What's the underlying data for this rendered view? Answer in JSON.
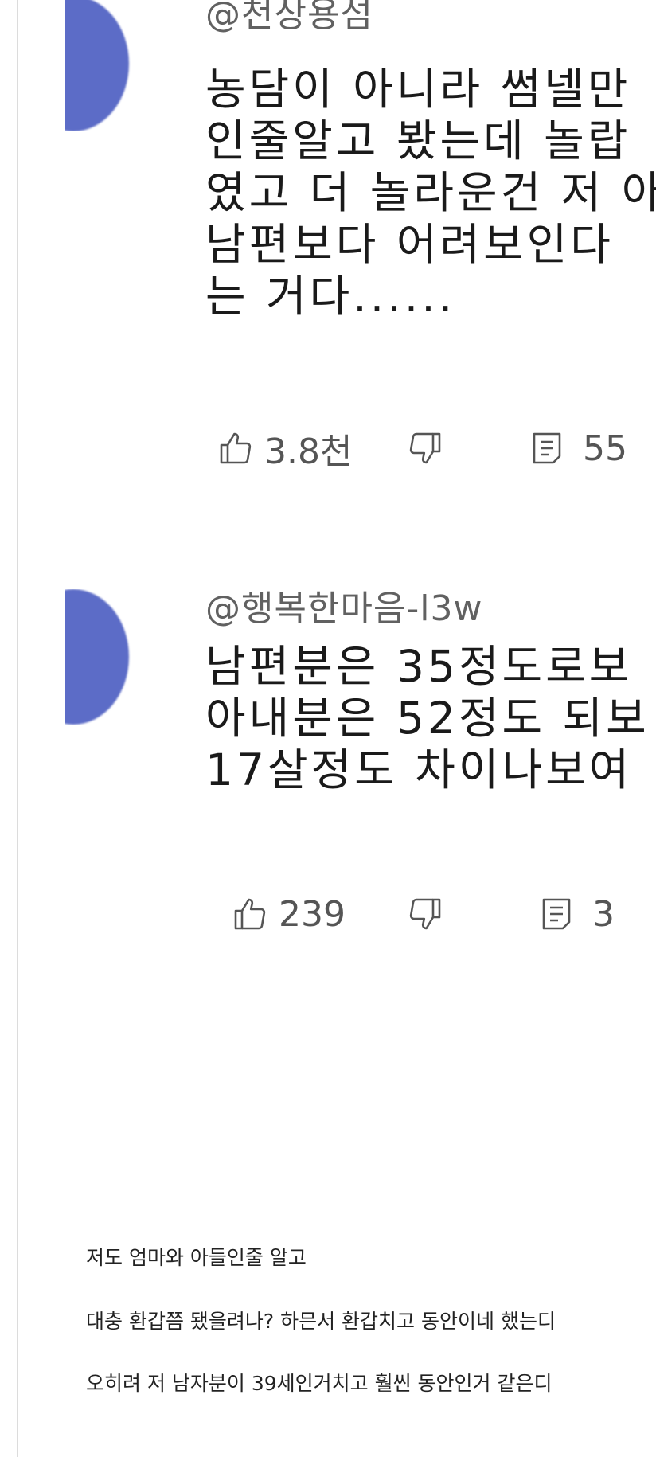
{
  "comments": [
    {
      "handle": "@천상용섬",
      "lines": [
        "농담이 아니라 썸넬만",
        "인줄알고 봤는데 놀랍",
        "였고 더 놀라운건 저 아",
        "남편보다 어려보인다",
        "는 거다......"
      ],
      "likes": "3.8천",
      "replies": "55"
    },
    {
      "handle": "@행복한마음-l3w",
      "lines": [
        "남편분은 35정도로보",
        "아내분은 52정도 되보",
        "17살정도 차이나보여"
      ],
      "likes": "239",
      "replies": "3"
    }
  ],
  "icons": {
    "like": "thumbs-up-icon",
    "dislike": "thumbs-down-icon",
    "reply": "comment-icon"
  },
  "colors": {
    "avatar": "#5c6cc7",
    "handle": "#616161",
    "text": "#1a1a1a",
    "action": "#555555"
  },
  "post": {
    "paragraphs": [
      "저도 엄마와 아들인줄 알고",
      "대충 환갑쯤 됐을려나? 하믄서 환갑치고 동안이네 했는디",
      "오히려 저 남자분이 39세인거치고 훨씬 동안인거 같은디"
    ]
  }
}
